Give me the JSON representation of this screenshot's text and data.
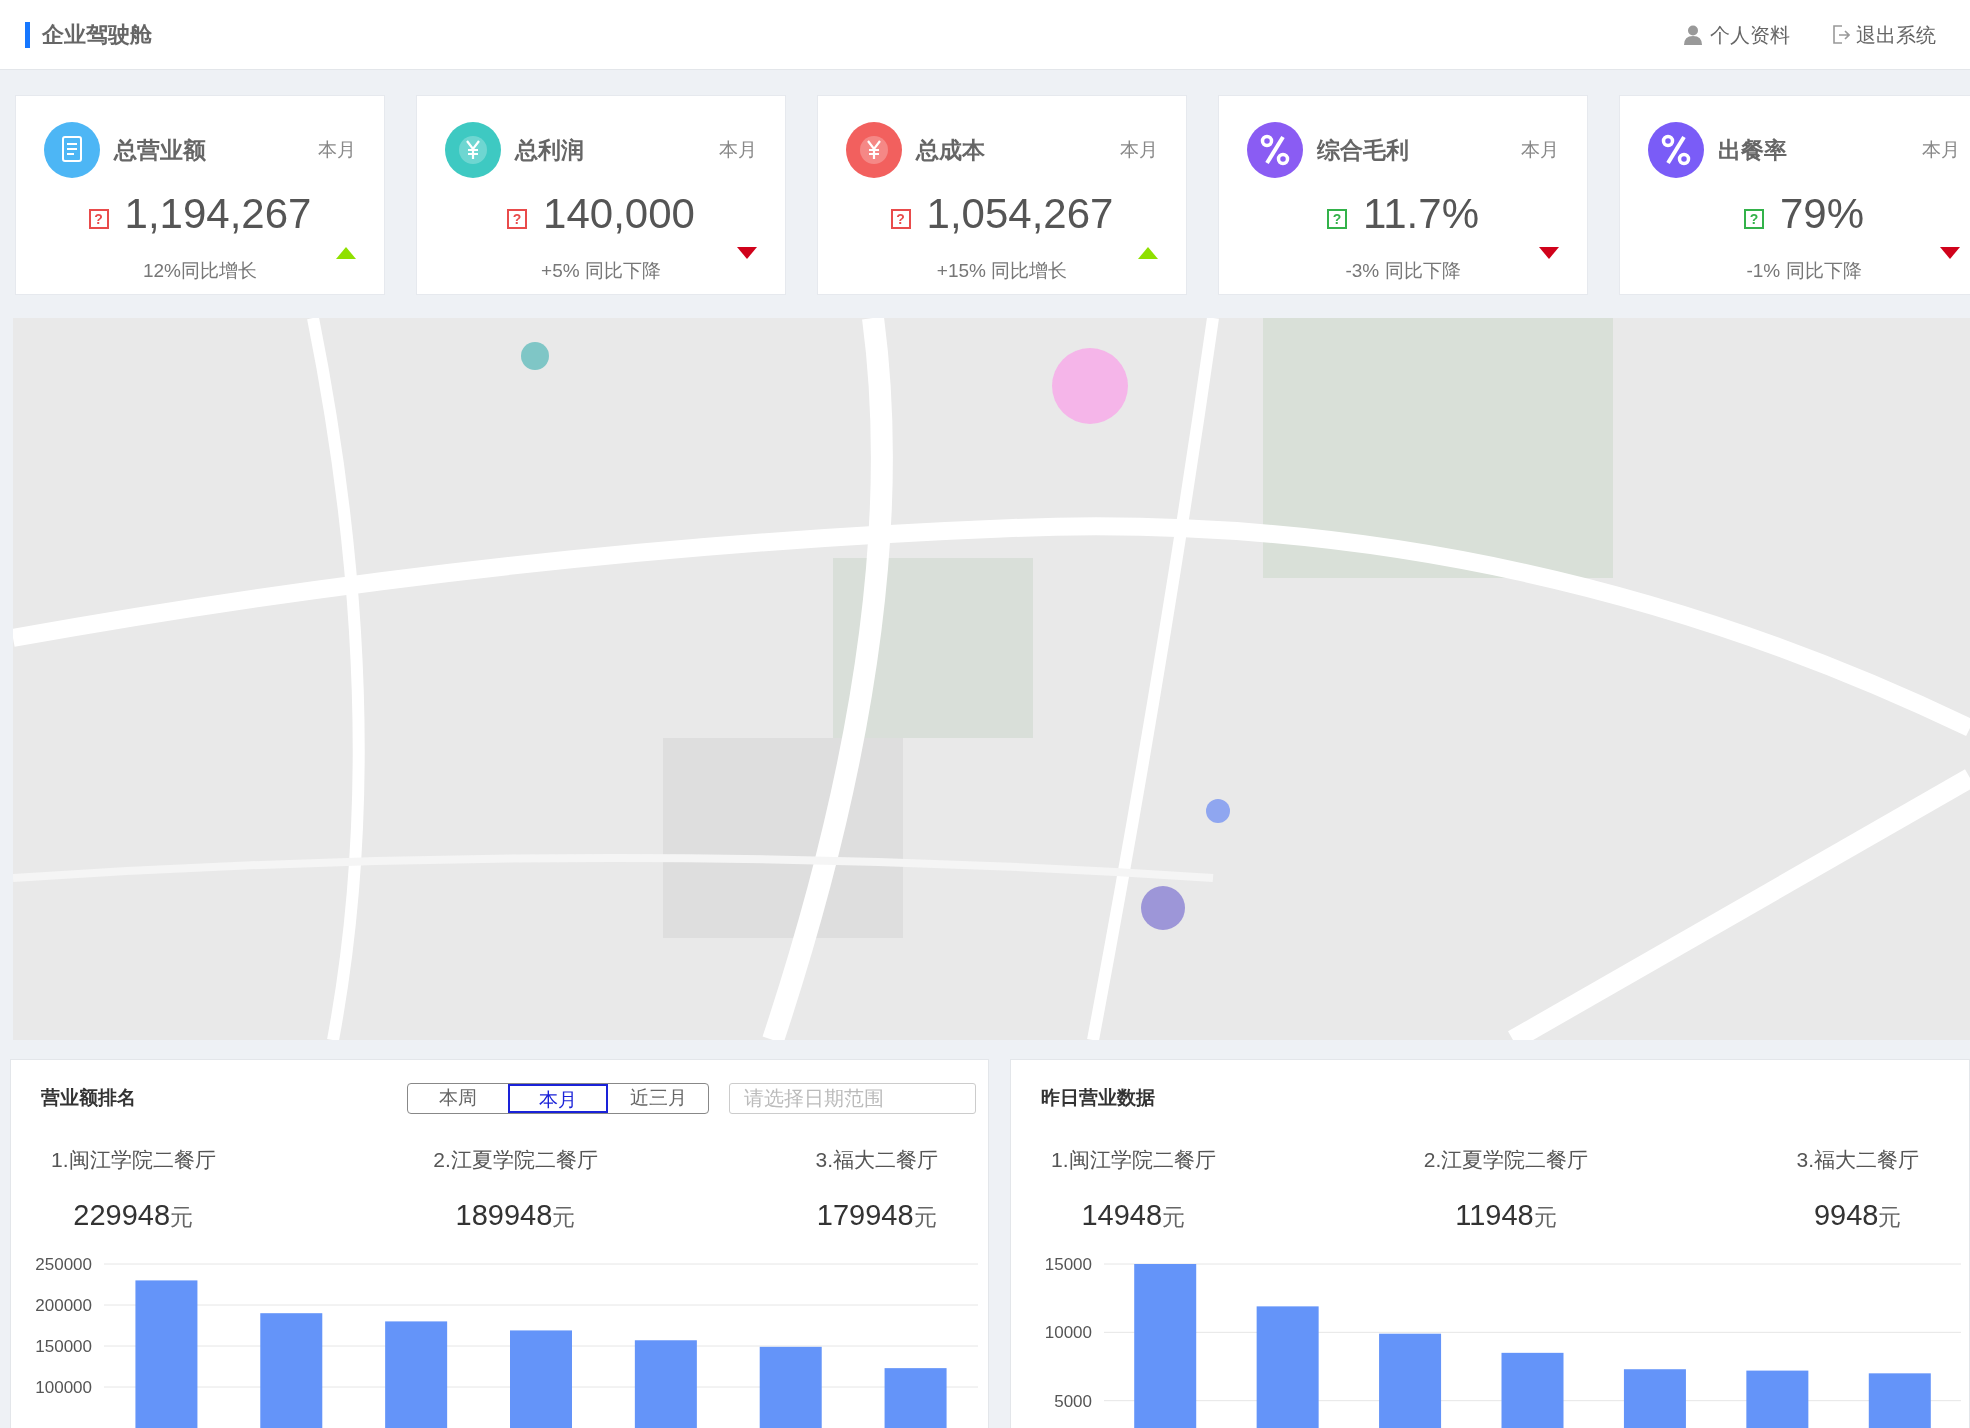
{
  "header": {
    "title": "企业驾驶舱",
    "profile": "个人资料",
    "logout": "退出系统"
  },
  "cards": [
    {
      "kind": "document",
      "color": "#4db6f5",
      "title": "总营业额",
      "period": "本月",
      "help_mark": "?",
      "alert": true,
      "value": "1,194,267",
      "rising": true,
      "change": "12%同比增长"
    },
    {
      "kind": "yen",
      "color": "#3ec9c2",
      "title": "总利润",
      "period": "本月",
      "help_mark": "?",
      "alert": true,
      "value": "140,000",
      "rising": false,
      "change": "+5% 同比下降"
    },
    {
      "kind": "yen",
      "color": "#f2605e",
      "title": "总成本",
      "period": "本月",
      "help_mark": "?",
      "alert": true,
      "value": "1,054,267",
      "rising": true,
      "change": "+15% 同比增长"
    },
    {
      "kind": "percent",
      "color": "#8a5cf3",
      "title": "综合毛利",
      "period": "本月",
      "help_mark": "?",
      "alert": false,
      "value": "11.7%",
      "rising": false,
      "change": "-3% 同比下降"
    },
    {
      "kind": "percent",
      "color": "#7a5cf7",
      "title": "出餐率",
      "period": "本月",
      "help_mark": "?",
      "alert": false,
      "value": "79%",
      "rising": false,
      "change": "-1% 同比下降"
    }
  ],
  "ranking_panel": {
    "title": "营业额排名",
    "tabs": [
      {
        "label": "本周",
        "selected": false
      },
      {
        "label": "本月",
        "selected": true
      },
      {
        "label": "近三月",
        "selected": false
      }
    ],
    "date_range": {
      "placeholder": "请选择日期范围"
    },
    "top": [
      {
        "name": "1.闽江学院二餐厅",
        "amount": "229948",
        "unit": "元"
      },
      {
        "name": "2.江夏学院二餐厅",
        "amount": "189948",
        "unit": "元"
      },
      {
        "name": "3.福大二餐厅",
        "amount": "179948",
        "unit": "元"
      }
    ],
    "chart_data": {
      "type": "bar",
      "grid": true,
      "ylim": [
        50000,
        250000
      ],
      "yticks": [
        100000,
        150000,
        200000,
        250000
      ],
      "series": [
        {
          "color": "#6494f9",
          "values": [
            230000,
            190000,
            180000,
            169000,
            157000,
            149000,
            123000
          ]
        }
      ]
    }
  },
  "yesterday_panel": {
    "title": "昨日营业数据",
    "top": [
      {
        "name": "1.闽江学院二餐厅",
        "amount": "14948",
        "unit": "元"
      },
      {
        "name": "2.江夏学院二餐厅",
        "amount": "11948",
        "unit": "元"
      },
      {
        "name": "3.福大二餐厅",
        "amount": "9948",
        "unit": "元"
      }
    ],
    "chart_data": {
      "type": "bar",
      "grid": true,
      "ylim": [
        3000,
        15000
      ],
      "yticks": [
        5000,
        10000,
        15000
      ],
      "series": [
        {
          "color": "#6494f9",
          "values": [
            15000,
            11900,
            9900,
            8500,
            7300,
            7200,
            7000
          ]
        }
      ]
    }
  }
}
